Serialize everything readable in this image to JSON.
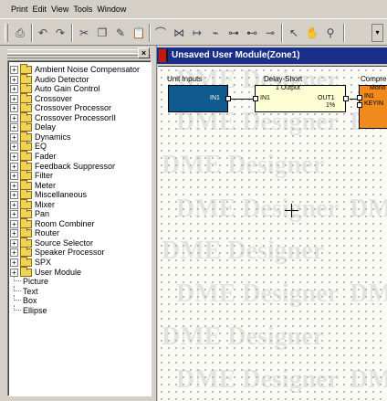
{
  "menu": [
    "Print",
    "Edit",
    "View",
    "Tools",
    "Window"
  ],
  "toolbar": {
    "buttons": [
      {
        "name": "print-icon",
        "glyph": "⎙"
      },
      {
        "name": "undo-icon",
        "glyph": "↶"
      },
      {
        "name": "redo-icon",
        "glyph": "↷"
      },
      {
        "name": "cut-icon",
        "glyph": "✂"
      },
      {
        "name": "copy-icon",
        "glyph": "❐"
      },
      {
        "name": "pencil-icon",
        "glyph": "✎"
      },
      {
        "name": "paste-icon",
        "glyph": "📋"
      },
      {
        "name": "wire-arc-icon",
        "glyph": "⌒"
      },
      {
        "name": "mirror-icon",
        "glyph": "⋈"
      },
      {
        "name": "connect-icon",
        "glyph": "↦"
      },
      {
        "name": "link-icon",
        "glyph": "⌁"
      },
      {
        "name": "branch-icon",
        "glyph": "⊶"
      },
      {
        "name": "merge-icon",
        "glyph": "⊷"
      },
      {
        "name": "node-icon",
        "glyph": "⊸"
      },
      {
        "name": "pointer-icon",
        "glyph": "↖"
      },
      {
        "name": "hand-icon",
        "glyph": "✋"
      },
      {
        "name": "zoom-icon",
        "glyph": "⚲"
      }
    ],
    "dropdown_glyph": "▾"
  },
  "tree": {
    "close_glyph": "×",
    "folders": [
      "Ambient Noise Compensator",
      "Audio Detector",
      "Auto Gain Control",
      "Crossover",
      "Crossover Processor",
      "Crossover ProcessorII",
      "Delay",
      "Dynamics",
      "EQ",
      "Fader",
      "Feedback Suppressor",
      "Filter",
      "Meter",
      "Miscellaneous",
      "Mixer",
      "Pan",
      "Room Combiner",
      "Router",
      "Source Selector",
      "Speaker Processor",
      "SPX",
      "User Module"
    ],
    "leaves": [
      "Picture",
      "Text",
      "Box",
      "Ellipse"
    ],
    "expander_glyph": "+"
  },
  "window": {
    "title": "Unsaved User Module(Zone1)",
    "watermark": "DME Designer"
  },
  "modules": {
    "unit_inputs": {
      "title": "Unit Inputs",
      "port": "IN1"
    },
    "delay": {
      "title": "Delay-Short",
      "output": "1 Output",
      "in_port": "IN1",
      "out_port": "OUT1",
      "value": "1%"
    },
    "compressor": {
      "title": "Compres",
      "label": "Mono",
      "in_port": "IN1",
      "key_port": "KEYIN"
    }
  },
  "colors": {
    "unit_inputs_fill": "#0f5a8e",
    "delay_fill": "#fdfdd4",
    "compressor_fill": "#f08a1c",
    "title_bar": "#1a2f8a"
  }
}
